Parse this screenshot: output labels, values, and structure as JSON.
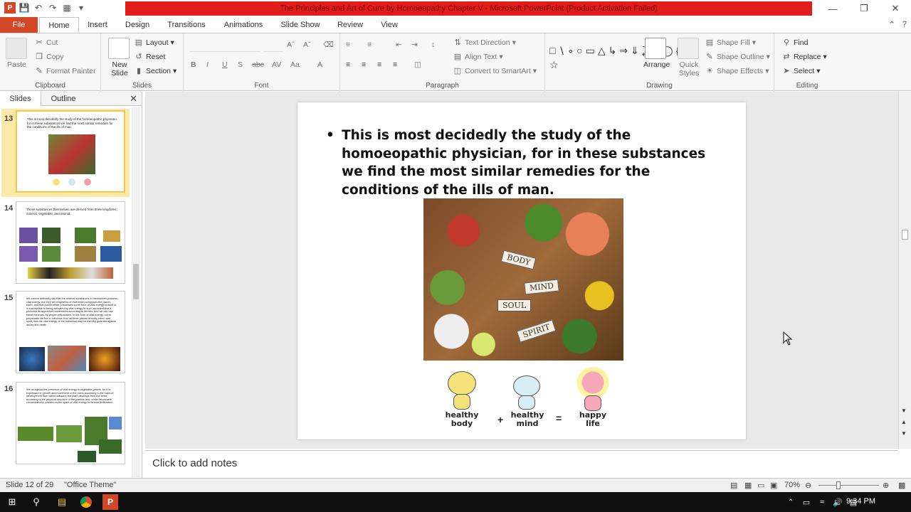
{
  "window": {
    "title": "The Principles and Art of Cure by Homoeopathy Chapter V  -  Microsoft PowerPoint (Product Activation Failed)",
    "accent_color": "#e21b1b"
  },
  "tabs": {
    "file": "File",
    "items": [
      "Home",
      "Insert",
      "Design",
      "Transitions",
      "Animations",
      "Slide Show",
      "Review",
      "View"
    ],
    "active": "Home"
  },
  "ribbon": {
    "clipboard": {
      "label": "Clipboard",
      "paste": "Paste",
      "cut": "Cut",
      "copy": "Copy",
      "format_painter": "Format Painter"
    },
    "slides": {
      "label": "Slides",
      "new_slide": "New Slide",
      "layout": "Layout",
      "reset": "Reset",
      "section": "Section"
    },
    "font": {
      "label": "Font"
    },
    "paragraph": {
      "label": "Paragraph",
      "text_direction": "Text Direction",
      "align_text": "Align Text",
      "convert_smartart": "Convert to SmartArt"
    },
    "drawing": {
      "label": "Drawing",
      "arrange": "Arrange",
      "quick_styles": "Quick Styles",
      "shape_fill": "Shape Fill",
      "shape_outline": "Shape Outline",
      "shape_effects": "Shape Effects"
    },
    "editing": {
      "label": "Editing",
      "find": "Find",
      "replace": "Replace",
      "select": "Select"
    }
  },
  "left_panel": {
    "tabs": [
      "Slides",
      "Outline"
    ],
    "thumbnails": [
      {
        "num": "13",
        "text": "This is most decidedly the study of the homoeopathic physician, for in these substances we find the most similar remedies for the conditions of the ills of man."
      },
      {
        "num": "14",
        "text": "These substances themselves are derived from three kingdoms; mineral, vegetable, and animal."
      },
      {
        "num": "15",
        "text": "We cannot definitely say that the mineral substances in themselves possess vital energy, but they are fragments of that which composes the planet, earth, and that planet either possesses some form of vital energy in itself or is susceptible to being activated by vital energy to such an extent that it performs its appointed movements according to the law; and we can use these minerals, by proper preparation, in the form of vital energy, not to perpetuate life but to influence it on all three planes of body, mind, and spirit, that the vital energy of the individual may be thereby guarded against decay and death."
      },
      {
        "num": "16",
        "text": "We recognise the presence of vital energy in vegetable growth, for it is expressed in growth and movement in the plant, according to the rules of development from within outward; the plant develops from the seed according to the physical structure of the parents and, under favourable circumstances, passes on the spark of vital energy to its own fertilization."
      }
    ]
  },
  "slide": {
    "bullet": "This is most decidedly the study of the homoeopathic physician, for in these substances we find the most similar remedies for the conditions of the ills of man.",
    "image_labels": [
      "BODY",
      "MIND",
      "SOUL",
      "SPIRIT"
    ],
    "figures": {
      "healthy_body": "healthy body",
      "healthy_mind": "healthy mind",
      "happy_life": "happy life",
      "plus": "+",
      "equals": "="
    }
  },
  "notes": {
    "placeholder": "Click to add notes"
  },
  "status": {
    "slide_info": "Slide 12 of 29",
    "theme": "\"Office Theme\"",
    "zoom": "70%"
  },
  "taskbar": {
    "time": "9:34 PM"
  }
}
